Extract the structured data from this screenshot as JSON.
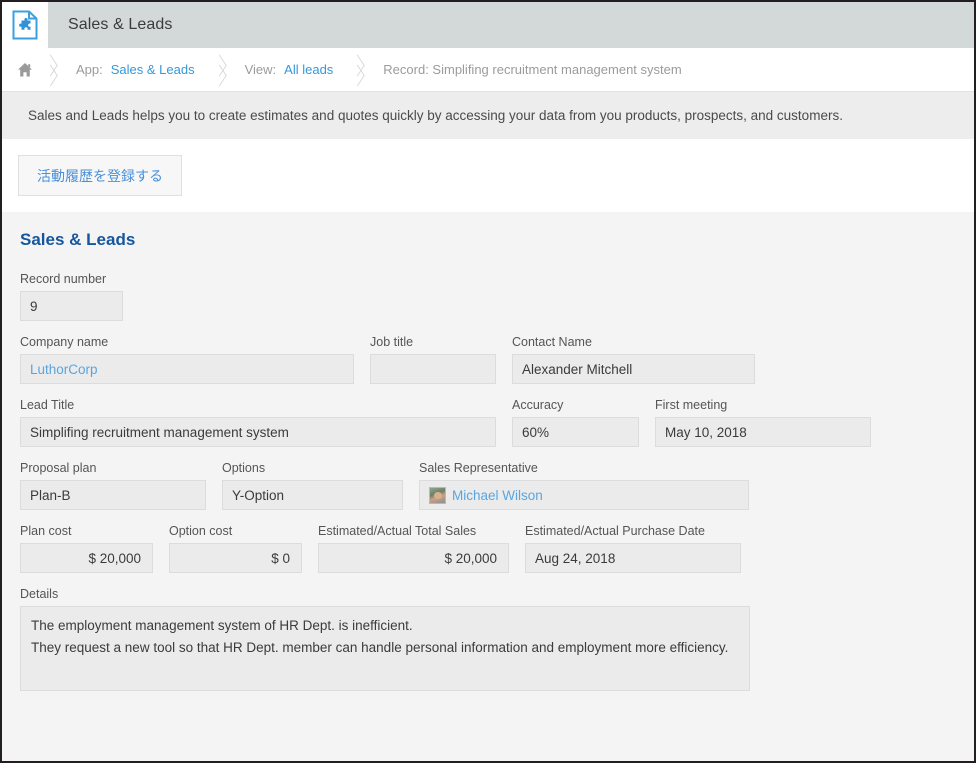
{
  "header": {
    "app_icon": "document-puzzle-icon",
    "title": "Sales & Leads"
  },
  "breadcrumb": {
    "home_icon": "home-icon",
    "app_prefix": "App:",
    "app_name": "Sales & Leads",
    "view_prefix": "View:",
    "view_name": "All leads",
    "record": "Record: Simplifing recruitment management system"
  },
  "description": "Sales and Leads helps you to create estimates and quotes quickly by accessing your data from you products, prospects, and customers.",
  "actions": {
    "register_activity": "活動履歴を登録する"
  },
  "record": {
    "title": "Sales & Leads",
    "fields": {
      "record_number": {
        "label": "Record number",
        "value": "9"
      },
      "company_name": {
        "label": "Company name",
        "value": "LuthorCorp"
      },
      "job_title": {
        "label": "Job title",
        "value": ""
      },
      "contact_name": {
        "label": "Contact Name",
        "value": "Alexander Mitchell"
      },
      "lead_title": {
        "label": "Lead Title",
        "value": "Simplifing recruitment management system"
      },
      "accuracy": {
        "label": "Accuracy",
        "value": "60%"
      },
      "first_meeting": {
        "label": "First meeting",
        "value": "May 10, 2018"
      },
      "proposal_plan": {
        "label": "Proposal plan",
        "value": "Plan-B"
      },
      "options": {
        "label": "Options",
        "value": "Y-Option"
      },
      "sales_representative": {
        "label": "Sales Representative",
        "value": "Michael Wilson",
        "avatar": "user-photo-avatar"
      },
      "plan_cost": {
        "label": "Plan cost",
        "value": "$ 20,000"
      },
      "option_cost": {
        "label": "Option cost",
        "value": "$ 0"
      },
      "total_sales": {
        "label": "Estimated/Actual Total Sales",
        "value": "$ 20,000"
      },
      "purchase_date": {
        "label": "Estimated/Actual Purchase Date",
        "value": "Aug 24, 2018"
      },
      "details": {
        "label": "Details",
        "value": "The employment management system of HR Dept. is inefficient.\nThey request a new tool so that HR Dept. member can handle personal information and employment more efficiency."
      }
    }
  },
  "colors": {
    "link": "#3498db",
    "title": "#16569e",
    "header_bar": "#d3d8d9",
    "field_bg": "#ebebeb"
  }
}
